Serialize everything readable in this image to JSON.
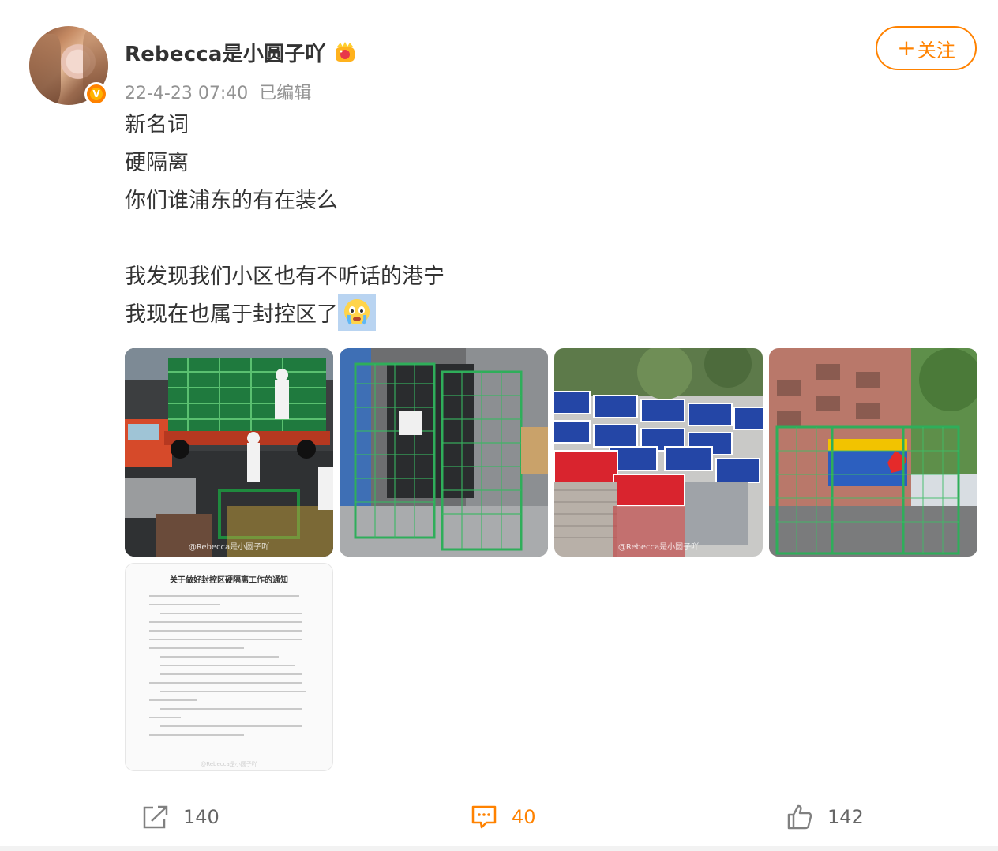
{
  "post": {
    "username": "Rebecca是小圆子吖",
    "timestamp": "22-4-23 07:40",
    "edited": "已编辑",
    "verified_badge": "V",
    "follow_button": {
      "plus": "+",
      "label": "关注"
    },
    "text_lines": [
      "新名词",
      "硬隔离",
      "你们谁浦东的有在装么",
      "",
      "我发现我们小区也有不听话的港宁",
      "我现在也属于封控区了"
    ],
    "emoji": "crying-face-emoji",
    "images": [
      {
        "icon": "photo-truck-fences",
        "watermark": "@Rebecca是小圆子吖"
      },
      {
        "icon": "photo-green-gate",
        "watermark": ""
      },
      {
        "icon": "photo-control-signs",
        "watermark": "@Rebecca是小圆子吖"
      },
      {
        "icon": "photo-building-fence",
        "watermark": ""
      },
      {
        "icon": "photo-notice-document",
        "title": "关于做好封控区硬隔离工作的通知",
        "watermark": "@Rebecca是小圆子吖"
      }
    ]
  },
  "toolbar": {
    "repost_count": "140",
    "comment_count": "40",
    "like_count": "142"
  },
  "colors": {
    "accent": "#ff8200",
    "meta_gray": "#939393",
    "text": "#333333"
  }
}
